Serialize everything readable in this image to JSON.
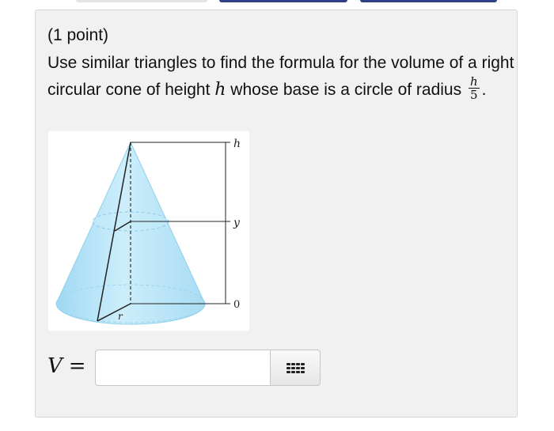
{
  "problem": {
    "points": "(1 point)",
    "question_part1": "Use similar triangles to find the formula for the volume of a right circular cone of height ",
    "height_var": "h",
    "question_part2": " whose base is a circle of radius ",
    "radius_fraction": {
      "numerator": "h",
      "denominator": "5"
    },
    "question_end": "."
  },
  "figure": {
    "labels": {
      "top": "h",
      "middle": "y",
      "bottom": "0",
      "radius": "r"
    },
    "colors": {
      "cone_fill": "#bfe6f7",
      "cone_edge": "#7fc7e9",
      "lines": "#222222"
    }
  },
  "answer": {
    "variable": "V",
    "equals": "=",
    "input_value": "",
    "palette_icon": "grid-icon"
  },
  "colors": {
    "top_tab_light": "#e4e4e4",
    "top_tab_dark": "#2d3f86",
    "panel_bg": "#f1f1f1"
  }
}
